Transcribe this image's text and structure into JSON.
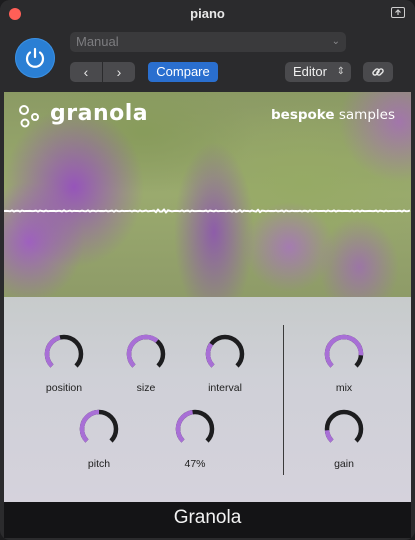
{
  "window": {
    "title": "piano"
  },
  "toolbar": {
    "preset": "Manual",
    "compare_label": "Compare",
    "view_select": "Editor",
    "nav_prev": "‹",
    "nav_next": "›"
  },
  "plugin": {
    "logo_text": "granola",
    "brand_bold": "bespoke",
    "brand_regular": " samples",
    "name": "Granola"
  },
  "knobs": [
    {
      "label": "position",
      "value": 0.45
    },
    {
      "label": "size",
      "value": 0.65
    },
    {
      "label": "interval",
      "value": 0.3
    },
    {
      "label": "mix",
      "value": 0.85
    },
    {
      "label": "pitch",
      "value": 0.5
    },
    {
      "label": "47%",
      "value": 0.47
    },
    {
      "label": "gain",
      "value": 0.15
    }
  ],
  "colors": {
    "accent": "#2a6fcf",
    "power": "#2a7fd4",
    "knob_value": "#a86fd6",
    "knob_track": "#1d1d1f",
    "close": "#ff5f57"
  }
}
